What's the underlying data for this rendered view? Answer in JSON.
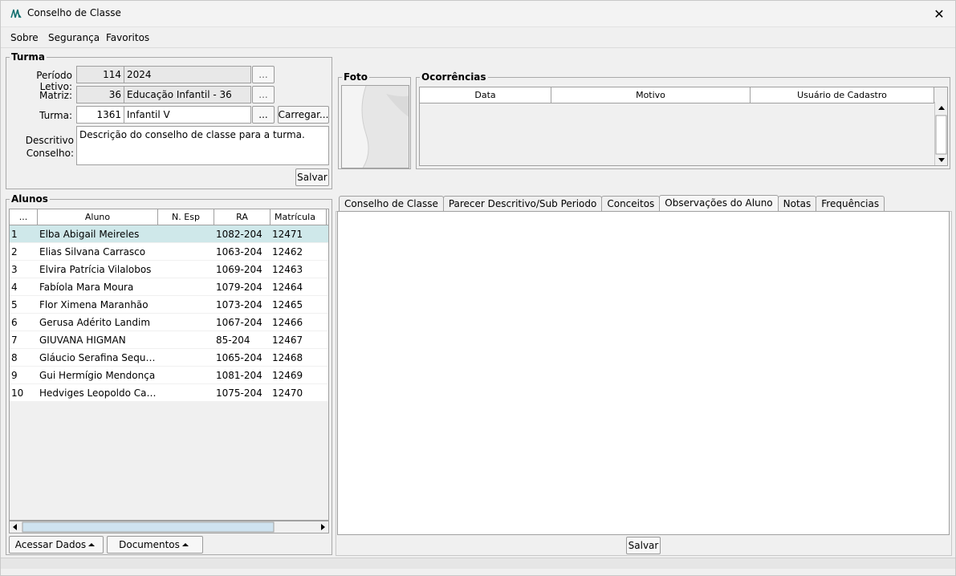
{
  "window": {
    "title": "Conselho de Classe",
    "close_glyph": "✕"
  },
  "menu": [
    {
      "label": "Sobre"
    },
    {
      "label": "Segurança"
    },
    {
      "label": "Favoritos"
    }
  ],
  "turma": {
    "legend": "Turma",
    "periodo_label": "Período Letivo:",
    "periodo_code": "114",
    "periodo_name": "2024",
    "matriz_label": "Matriz:",
    "matriz_code": "36",
    "matriz_name": "Educação Infantil - 36",
    "turma_label": "Turma:",
    "turma_code": "1361",
    "turma_name": "Infantil V",
    "browse_label": "...",
    "carregar_label": "Carregar...",
    "descritivo_label_1": "Descritivo",
    "descritivo_label_2": "Conselho:",
    "descritivo_value": "Descrição do conselho de classe para a turma.",
    "salvar_label": "Salvar"
  },
  "foto": {
    "legend": "Foto"
  },
  "ocorrencias": {
    "legend": "Ocorrências",
    "columns": [
      "Data",
      "Motivo",
      "Usuário de Cadastro"
    ]
  },
  "alunos": {
    "legend": "Alunos",
    "columns": [
      "...",
      "Aluno",
      "N. Esp",
      "RA",
      "Matrícula"
    ],
    "rows": [
      {
        "n": "1",
        "aluno": "Elba Abigail Meireles",
        "esp": "",
        "ra": "1082-204",
        "matricula": "12471"
      },
      {
        "n": "2",
        "aluno": "Elias Silvana Carrasco",
        "esp": "",
        "ra": "1063-204",
        "matricula": "12462"
      },
      {
        "n": "3",
        "aluno": "Elvira Patrícia Vilalobos",
        "esp": "",
        "ra": "1069-204",
        "matricula": "12463"
      },
      {
        "n": "4",
        "aluno": "Fabíola Mara Moura",
        "esp": "",
        "ra": "1079-204",
        "matricula": "12464"
      },
      {
        "n": "5",
        "aluno": "Flor Ximena Maranhão",
        "esp": "",
        "ra": "1073-204",
        "matricula": "12465"
      },
      {
        "n": "6",
        "aluno": "Gerusa Adérito Landim",
        "esp": "",
        "ra": "1067-204",
        "matricula": "12466"
      },
      {
        "n": "7",
        "aluno": "GIUVANA HIGMAN",
        "esp": "",
        "ra": "85-204",
        "matricula": "12467"
      },
      {
        "n": "8",
        "aluno": "Gláucio Serafina Sequeira",
        "esp": "",
        "ra": "1065-204",
        "matricula": "12468"
      },
      {
        "n": "9",
        "aluno": "Gui Hermígio Mendonça",
        "esp": "",
        "ra": "1081-204",
        "matricula": "12469"
      },
      {
        "n": "10",
        "aluno": "Hedviges Leopoldo Casqu...",
        "esp": "",
        "ra": "1075-204",
        "matricula": "12470"
      }
    ],
    "acessar_label": "Acessar Dados",
    "documentos_label": "Documentos"
  },
  "tabs": [
    {
      "label": "Conselho de Classe",
      "active": false
    },
    {
      "label": "Parecer Descritivo/Sub Periodo",
      "active": false
    },
    {
      "label": "Conceitos",
      "active": false
    },
    {
      "label": "Observações do Aluno",
      "active": true
    },
    {
      "label": "Notas",
      "active": false
    },
    {
      "label": "Frequências",
      "active": false
    }
  ],
  "panel": {
    "salvar_label": "Salvar"
  },
  "colors": {
    "selected_row": "#cfe8ea",
    "accent": "#0f6e6e"
  }
}
